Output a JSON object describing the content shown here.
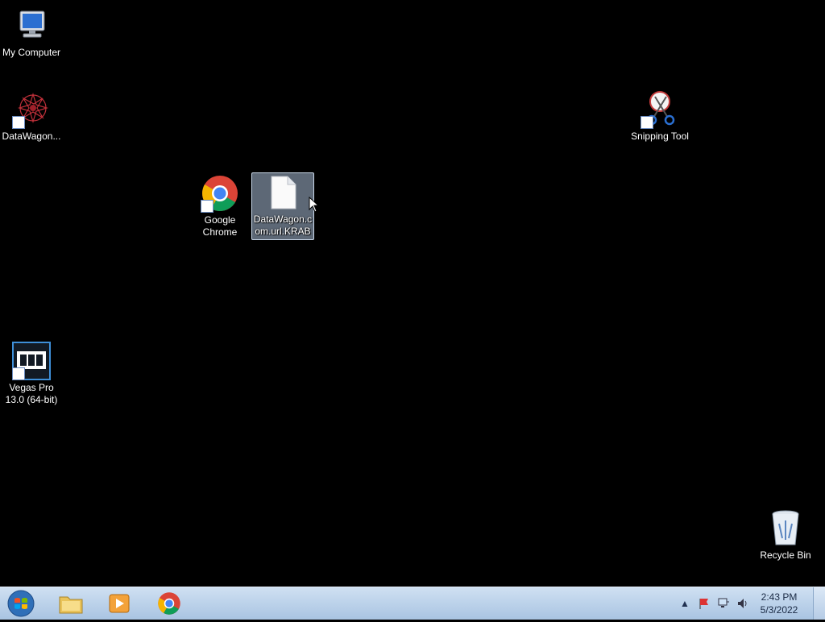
{
  "desktop": {
    "icons": {
      "my_computer": {
        "label": "My Computer"
      },
      "datawagon": {
        "label": "DataWagon..."
      },
      "snipping_tool": {
        "label": "Snipping Tool"
      },
      "google_chrome": {
        "label": "Google Chrome"
      },
      "datawagon_file": {
        "label": "DataWagon.com.url.KRAB"
      },
      "vegas_pro": {
        "label": "Vegas Pro 13.0 (64-bit)"
      },
      "recycle_bin": {
        "label": "Recycle Bin"
      }
    }
  },
  "taskbar": {
    "apps": [
      "windows-explorer",
      "media-player",
      "google-chrome"
    ],
    "clock": {
      "time": "2:43 PM",
      "date": "5/3/2022"
    }
  },
  "colors": {
    "desktop_bg": "#000000",
    "taskbar": "#b8d0ea",
    "selection": "#aabed7"
  }
}
